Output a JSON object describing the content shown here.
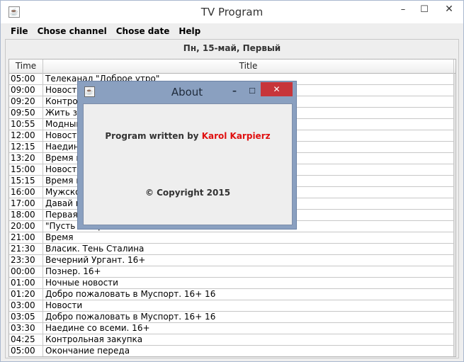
{
  "window": {
    "title": "TV Program"
  },
  "menu": {
    "items": [
      "File",
      "Chose channel",
      "Chose date",
      "Help"
    ]
  },
  "header": {
    "date_channel": "Пн, 15-май, Первый"
  },
  "table": {
    "columns": [
      "Time",
      "Title"
    ],
    "rows": [
      [
        "05:00",
        "Телеканал \"Доброе утро\""
      ],
      [
        "09:00",
        "Новости"
      ],
      [
        "09:20",
        "Контрольная закупка"
      ],
      [
        "09:50",
        "Жить здорово!"
      ],
      [
        "10:55",
        "Модный приговор"
      ],
      [
        "12:00",
        "Новости"
      ],
      [
        "12:15",
        "Наедине со всеми"
      ],
      [
        "13:20",
        "Время покажет"
      ],
      [
        "15:00",
        "Новости"
      ],
      [
        "15:15",
        "Время покажет"
      ],
      [
        "16:00",
        "Мужское / Женское"
      ],
      [
        "17:00",
        "Давай поженимся!"
      ],
      [
        "18:00",
        "Первая студия"
      ],
      [
        "20:00",
        "\"Пусть говорят\""
      ],
      [
        "21:00",
        "Время"
      ],
      [
        "21:30",
        "Власик. Тень Сталина"
      ],
      [
        "23:30",
        "Вечерний Ургант. 16+"
      ],
      [
        "00:00",
        "Познер. 16+"
      ],
      [
        "01:00",
        "Ночные новости"
      ],
      [
        "01:20",
        "Добро пожаловать в Муспорт. 16+ 16"
      ],
      [
        "03:00",
        "Новости"
      ],
      [
        "03:05",
        "Добро пожаловать в Муспорт. 16+ 16"
      ],
      [
        "03:30",
        "Наедине со всеми. 16+"
      ],
      [
        "04:25",
        "Контрольная закупка"
      ],
      [
        "05:00",
        "Окончание переда"
      ]
    ]
  },
  "about_dialog": {
    "title": "About",
    "program_prefix": "Program written by ",
    "author": "Karol Karpierz",
    "copyright": "© Copyright 2015",
    "author_color": "#e01010"
  },
  "icons": {
    "app": "java-cup-icon",
    "minimize": "minimize-icon",
    "maximize": "maximize-icon",
    "close": "close-icon"
  }
}
